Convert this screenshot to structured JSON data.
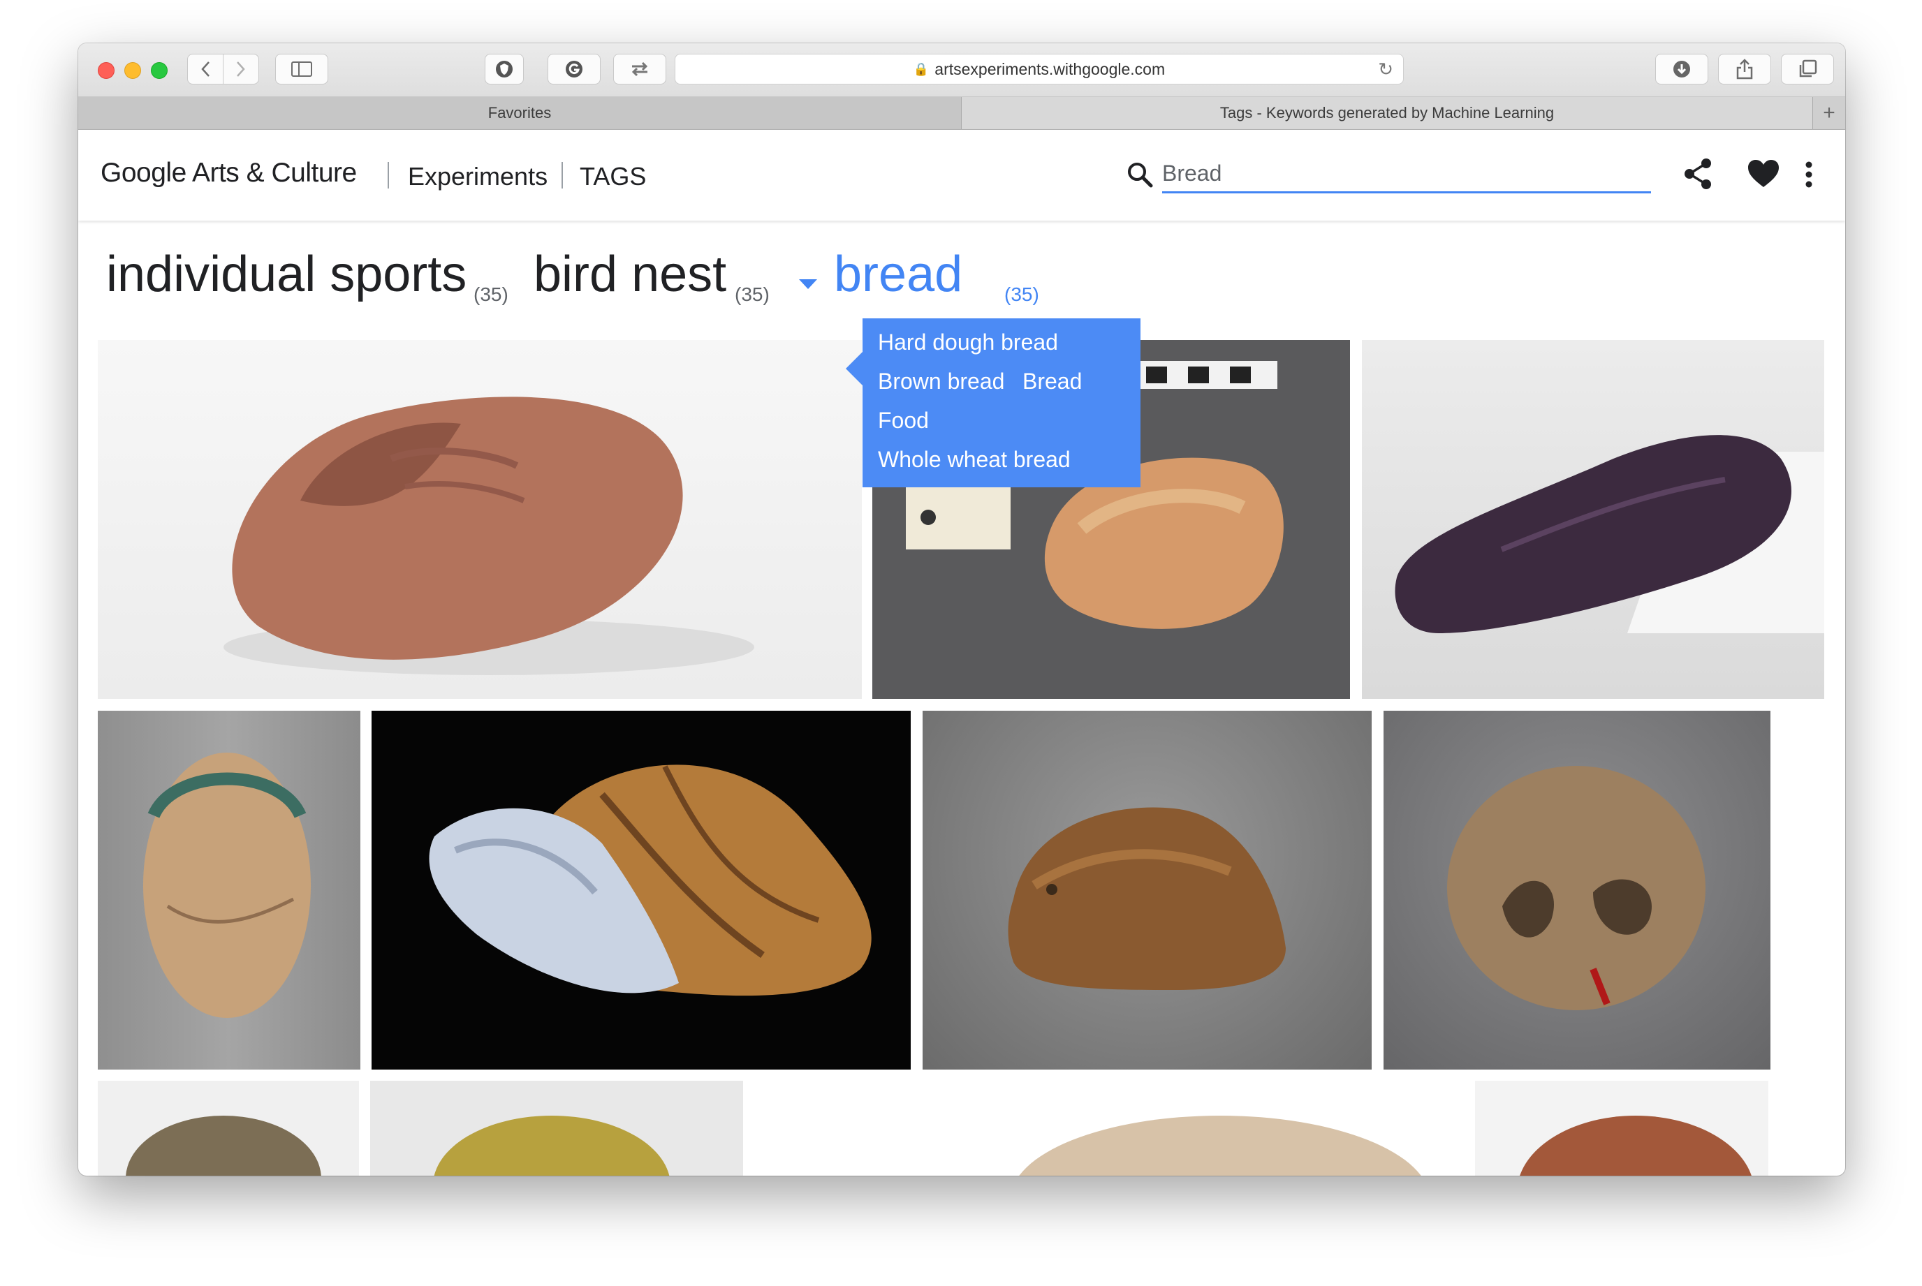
{
  "browser": {
    "url": "artsexperiments.withgoogle.com",
    "tabs": [
      {
        "label": "Favorites",
        "active": false
      },
      {
        "label": "Tags - Keywords generated by Machine Learning",
        "active": true
      }
    ]
  },
  "header": {
    "brand": "Google Arts & Culture",
    "experiments": "Experiments",
    "section": "TAGS",
    "search_value": "Bread",
    "icons": [
      "search-icon",
      "share-icon",
      "heart-icon",
      "more-vert-icon"
    ]
  },
  "tags": [
    {
      "label": "individual sports",
      "count": "(35)"
    },
    {
      "label": "bird nest",
      "count": "(35)"
    },
    {
      "label": "bread",
      "count": "(35)",
      "active": true
    }
  ],
  "popup": {
    "items": [
      "Hard dough bread",
      "Brown bread",
      "Bread",
      "Food",
      "Whole wheat bread"
    ]
  },
  "colors": {
    "accent": "#4285f4",
    "popup_bg": "#4c8bf5",
    "traffic_red": "#fe5f57",
    "traffic_yellow": "#febc2e",
    "traffic_green": "#28c840"
  }
}
